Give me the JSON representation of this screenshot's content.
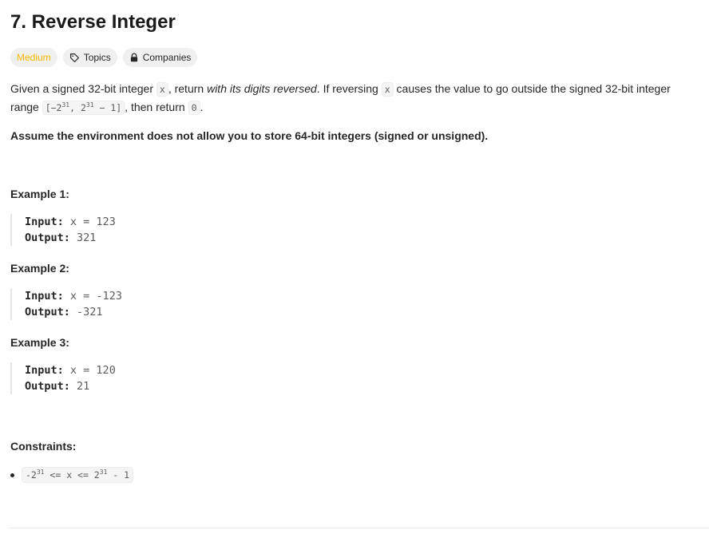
{
  "problem": {
    "title": "7. Reverse Integer",
    "difficulty": "Medium",
    "topics_label": "Topics",
    "companies_label": "Companies"
  },
  "description": {
    "p1_a": "Given a signed 32-bit integer ",
    "code_x": "x",
    "p1_b": ", return ",
    "p1_italic": "with its digits reversed",
    "p1_c": ". If reversing ",
    "p1_d": " causes the value to go outside the signed 32-bit integer range ",
    "range_a": "[−2",
    "range_exp1": "31",
    "range_b": ", 2",
    "range_exp2": "31",
    "range_c": " − 1]",
    "p1_e": ", then return ",
    "code_zero": "0",
    "p1_f": ".",
    "assumption": "Assume the environment does not allow you to store 64-bit integers (signed or unsigned)."
  },
  "examples": [
    {
      "title": "Example 1:",
      "input_label": "Input:",
      "input": "x = 123",
      "output_label": "Output:",
      "output": "321"
    },
    {
      "title": "Example 2:",
      "input_label": "Input:",
      "input": "x = -123",
      "output_label": "Output:",
      "output": "-321"
    },
    {
      "title": "Example 3:",
      "input_label": "Input:",
      "input": "x = 120",
      "output_label": "Output:",
      "output": "21"
    }
  ],
  "constraints": {
    "title": "Constraints:",
    "item_a": "-2",
    "item_exp1": "31",
    "item_b": " <= x <= 2",
    "item_exp2": "31",
    "item_c": " - 1"
  }
}
